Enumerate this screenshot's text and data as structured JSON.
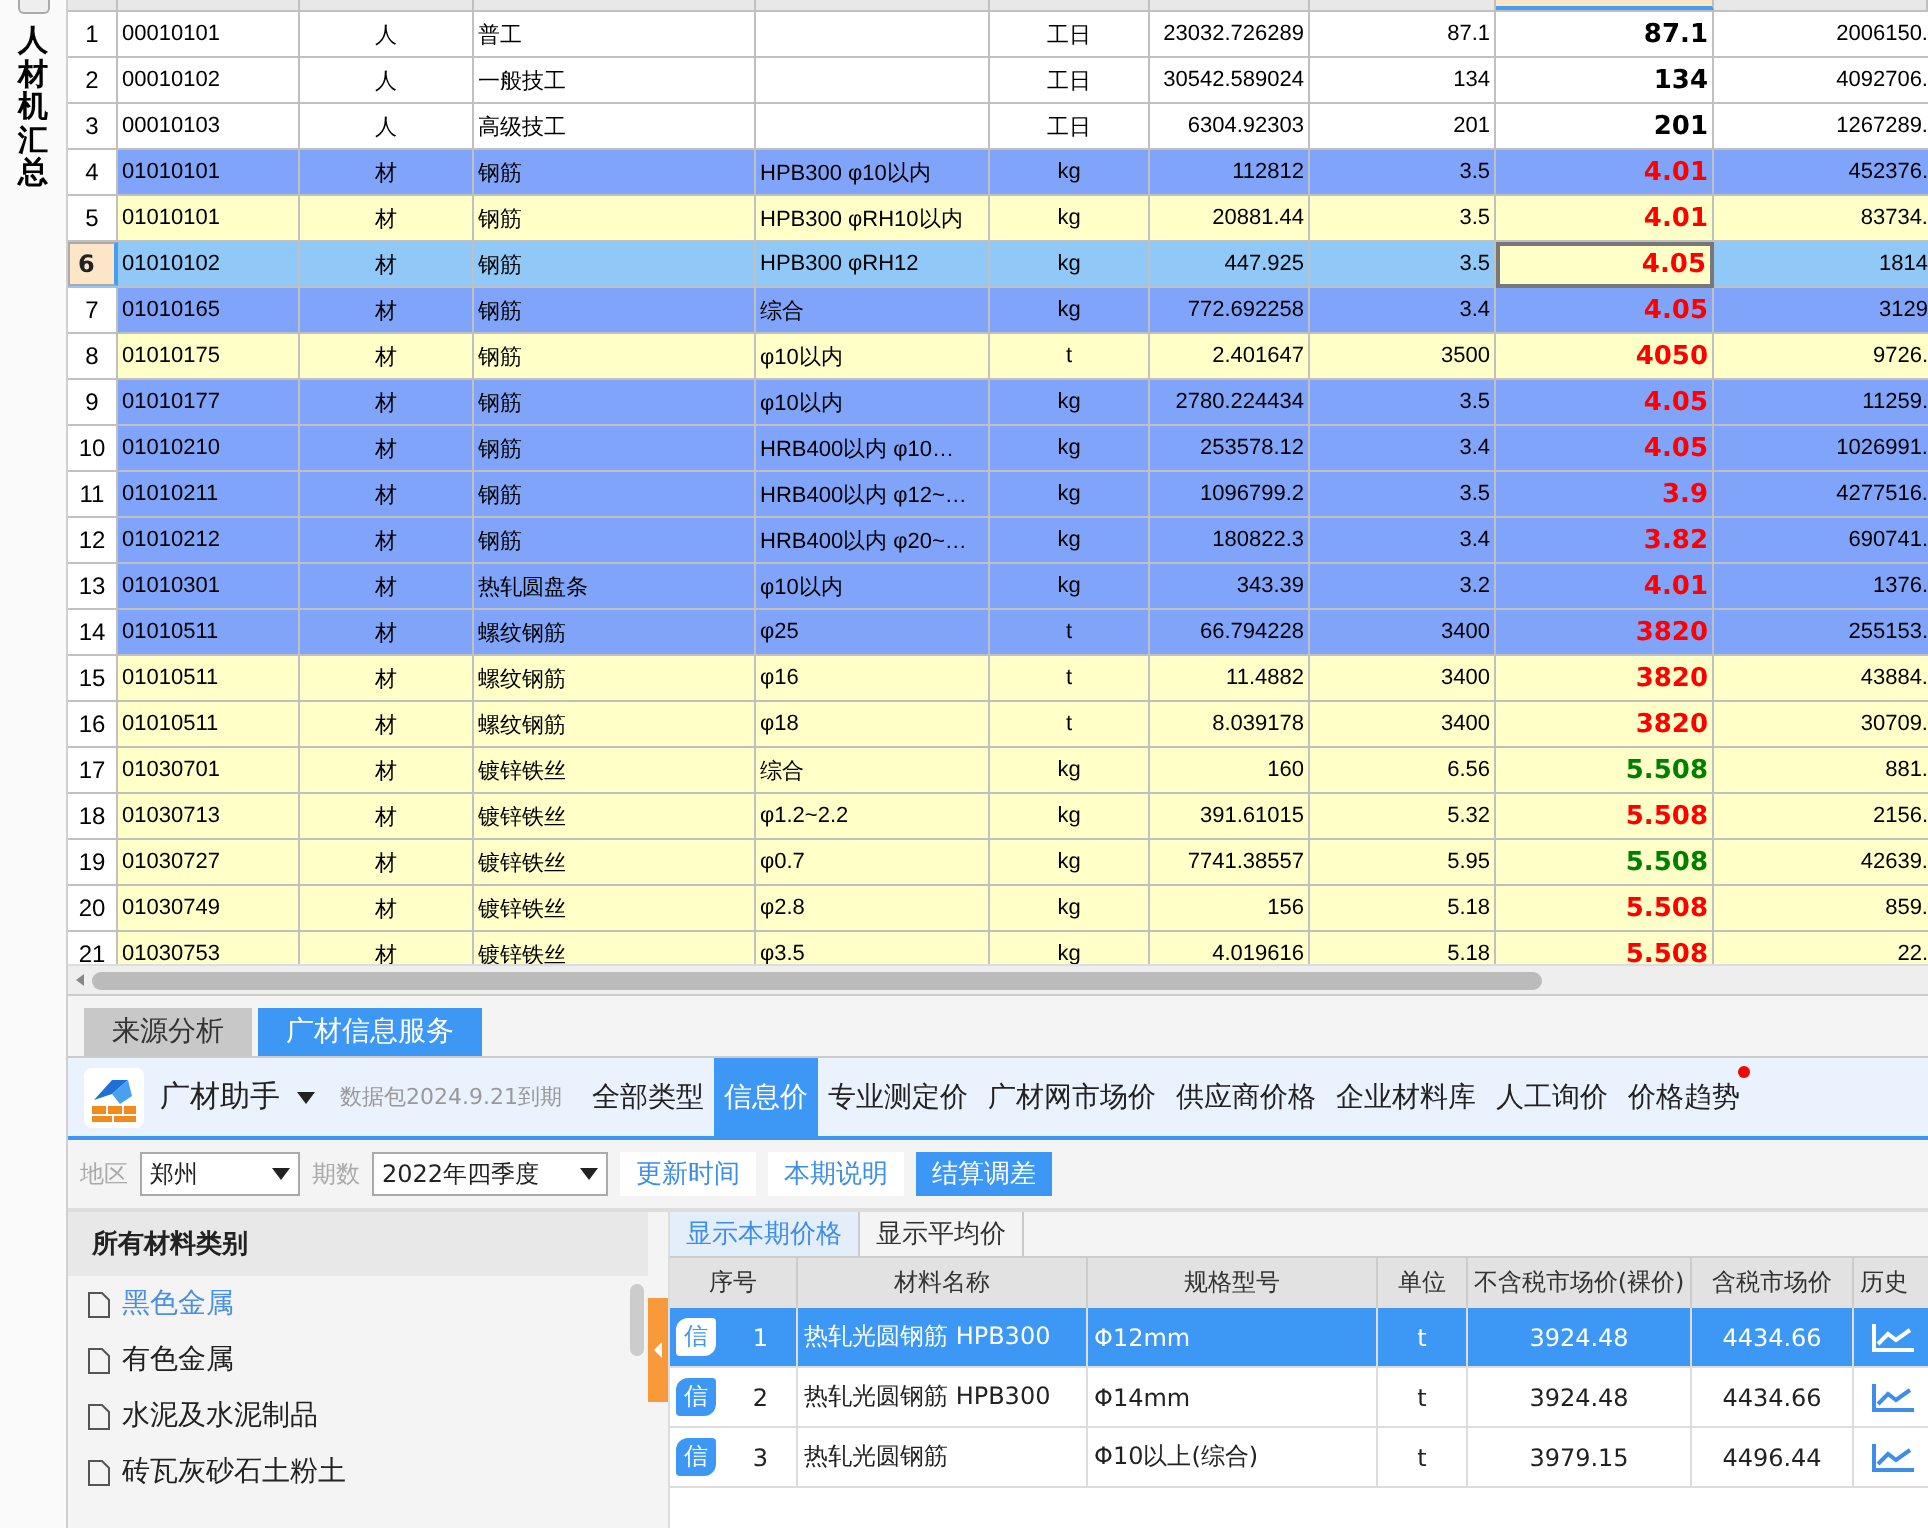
{
  "side_label": "人材机汇总",
  "grid": {
    "rows": [
      {
        "row_number": "1",
        "column_1": "00010101",
        "column_2": "人",
        "column_3": "普工",
        "column_5": "工日",
        "column_6": "23032.726289",
        "column_7": "87.1",
        "column_8": {
          "text": "87.1",
          "color": "#000000"
        },
        "column_9": "2006150.",
        "color": "#ffffff",
        "selected": false
      },
      {
        "row_number": "2",
        "column_1": "00010102",
        "column_2": "人",
        "column_3": "一般技工",
        "column_5": "工日",
        "column_6": "30542.589024",
        "column_7": "134",
        "column_8": {
          "text": "134",
          "color": "#000000"
        },
        "column_9": "4092706.",
        "color": "#ffffff",
        "selected": false
      },
      {
        "row_number": "3",
        "column_1": "00010103",
        "column_2": "人",
        "column_3": "高级技工",
        "column_5": "工日",
        "column_6": "6304.92303",
        "column_7": "201",
        "column_8": {
          "text": "201",
          "color": "#000000"
        },
        "column_9": "1267289.",
        "color": "#ffffff",
        "selected": false
      },
      {
        "row_number": "4",
        "column_1": "01010101",
        "column_2": "材",
        "column_3": "钢筋",
        "column_4": "HPB300 φ10以内",
        "column_5": "kg",
        "column_6": "112812",
        "column_7": "3.5",
        "column_8": {
          "text": "4.01",
          "color": "#ff0000"
        },
        "column_9": "452376.",
        "color": "#80a4fa",
        "selected": false
      },
      {
        "row_number": "5",
        "column_1": "01010101",
        "column_2": "材",
        "column_3": "钢筋",
        "column_4": "HPB300 φRH10以内",
        "column_5": "kg",
        "column_6": "20881.44",
        "column_7": "3.5",
        "column_8": {
          "text": "4.01",
          "color": "#ff0000"
        },
        "column_9": "83734.",
        "color": "#ffffc8",
        "selected": false
      },
      {
        "row_number": "6",
        "column_1": "01010102",
        "column_2": "材",
        "column_3": "钢筋",
        "column_4": "HPB300 φRH12",
        "column_5": "kg",
        "column_6": "447.925",
        "column_7": "3.5",
        "column_8": {
          "text": "4.05",
          "color": "#ff0000"
        },
        "column_9": "1814",
        "color": "#90c8f8",
        "selected": true
      },
      {
        "row_number": "7",
        "column_1": "01010165",
        "column_2": "材",
        "column_3": "钢筋",
        "column_4": "综合",
        "column_5": "kg",
        "column_6": "772.692258",
        "column_7": "3.4",
        "column_8": {
          "text": "4.05",
          "color": "#ff0000"
        },
        "column_9": "3129",
        "color": "#80a4fa",
        "selected": false
      },
      {
        "row_number": "8",
        "column_1": "01010175",
        "column_2": "材",
        "column_3": "钢筋",
        "column_4": "φ10以内",
        "column_5": "t",
        "column_6": "2.401647",
        "column_7": "3500",
        "column_8": {
          "text": "4050",
          "color": "#ff0000"
        },
        "column_9": "9726.",
        "color": "#ffffc8",
        "selected": false
      },
      {
        "row_number": "9",
        "column_1": "01010177",
        "column_2": "材",
        "column_3": "钢筋",
        "column_4": "φ10以内",
        "column_5": "kg",
        "column_6": "2780.224434",
        "column_7": "3.5",
        "column_8": {
          "text": "4.05",
          "color": "#ff0000"
        },
        "column_9": "11259.",
        "color": "#80a4fa",
        "selected": false
      },
      {
        "row_number": "10",
        "column_1": "01010210",
        "column_2": "材",
        "column_3": "钢筋",
        "column_4": "HRB400以内 φ10…",
        "column_5": "kg",
        "column_6": "253578.12",
        "column_7": "3.4",
        "column_8": {
          "text": "4.05",
          "color": "#ff0000"
        },
        "column_9": "1026991.",
        "color": "#80a4fa",
        "selected": false
      },
      {
        "row_number": "11",
        "column_1": "01010211",
        "column_2": "材",
        "column_3": "钢筋",
        "column_4": "HRB400以内 φ12~…",
        "column_5": "kg",
        "column_6": "1096799.2",
        "column_7": "3.5",
        "column_8": {
          "text": "3.9",
          "color": "#ff0000"
        },
        "column_9": "4277516.",
        "color": "#80a4fa",
        "selected": false
      },
      {
        "row_number": "12",
        "column_1": "01010212",
        "column_2": "材",
        "column_3": "钢筋",
        "column_4": "HRB400以内 φ20~…",
        "column_5": "kg",
        "column_6": "180822.3",
        "column_7": "3.4",
        "column_8": {
          "text": "3.82",
          "color": "#ff0000"
        },
        "column_9": "690741.",
        "color": "#80a4fa",
        "selected": false
      },
      {
        "row_number": "13",
        "column_1": "01010301",
        "column_2": "材",
        "column_3": "热轧圆盘条",
        "column_4": "φ10以内",
        "column_5": "kg",
        "column_6": "343.39",
        "column_7": "3.2",
        "column_8": {
          "text": "4.01",
          "color": "#ff0000"
        },
        "column_9": "1376.",
        "color": "#80a4fa",
        "selected": false
      },
      {
        "row_number": "14",
        "column_1": "01010511",
        "column_2": "材",
        "column_3": "螺纹钢筋",
        "column_4": "φ25",
        "column_5": "t",
        "column_6": "66.794228",
        "column_7": "3400",
        "column_8": {
          "text": "3820",
          "color": "#ff0000"
        },
        "column_9": "255153.",
        "color": "#80a4fa",
        "selected": false
      },
      {
        "row_number": "15",
        "column_1": "01010511",
        "column_2": "材",
        "column_3": "螺纹钢筋",
        "column_4": "φ16",
        "column_5": "t",
        "column_6": "11.4882",
        "column_7": "3400",
        "column_8": {
          "text": "3820",
          "color": "#ff0000"
        },
        "column_9": "43884.",
        "color": "#ffffc8",
        "selected": false
      },
      {
        "row_number": "16",
        "column_1": "01010511",
        "column_2": "材",
        "column_3": "螺纹钢筋",
        "column_4": "φ18",
        "column_5": "t",
        "column_6": "8.039178",
        "column_7": "3400",
        "column_8": {
          "text": "3820",
          "color": "#ff0000"
        },
        "column_9": "30709.",
        "color": "#ffffc8",
        "selected": false
      },
      {
        "row_number": "17",
        "column_1": "01030701",
        "column_2": "材",
        "column_3": "镀锌铁丝",
        "column_4": "综合",
        "column_5": "kg",
        "column_6": "160",
        "column_7": "6.56",
        "column_8": {
          "text": "5.508",
          "color": "#008000"
        },
        "column_9": "881.",
        "color": "#ffffc8",
        "selected": false
      },
      {
        "row_number": "18",
        "column_1": "01030713",
        "column_2": "材",
        "column_3": "镀锌铁丝",
        "column_4": "φ1.2~2.2",
        "column_5": "kg",
        "column_6": "391.61015",
        "column_7": "5.32",
        "column_8": {
          "text": "5.508",
          "color": "#ff0000"
        },
        "column_9": "2156.",
        "color": "#ffffc8",
        "selected": false
      },
      {
        "row_number": "19",
        "column_1": "01030727",
        "column_2": "材",
        "column_3": "镀锌铁丝",
        "column_4": "φ0.7",
        "column_5": "kg",
        "column_6": "7741.38557",
        "column_7": "5.95",
        "column_8": {
          "text": "5.508",
          "color": "#008000"
        },
        "column_9": "42639.",
        "color": "#ffffc8",
        "selected": false
      },
      {
        "row_number": "20",
        "column_1": "01030749",
        "column_2": "材",
        "column_3": "镀锌铁丝",
        "column_4": "φ2.8",
        "column_5": "kg",
        "column_6": "156",
        "column_7": "5.18",
        "column_8": {
          "text": "5.508",
          "color": "#ff0000"
        },
        "column_9": "859.",
        "color": "#ffffc8",
        "selected": false
      },
      {
        "row_number": "21",
        "column_1": "01030753",
        "column_2": "材",
        "column_3": "镀锌铁丝",
        "column_4": "φ3.5",
        "column_5": "kg",
        "column_6": "4.019616",
        "column_7": "5.18",
        "column_8": {
          "text": "5.508",
          "color": "#ff0000"
        },
        "column_9": "22.",
        "color": "#ffffc8",
        "selected": false
      }
    ]
  },
  "panel_tabs": [
    {
      "label": "来源分析",
      "selected": false
    },
    {
      "label": "广材信息服务",
      "selected": true
    }
  ],
  "assistant": {
    "title": "广材助手",
    "expiry": "数据包2024.9.21到期",
    "nav": [
      {
        "label": "全部类型",
        "selected": false,
        "badge": false
      },
      {
        "label": "信息价",
        "selected": true,
        "badge": false
      },
      {
        "label": "专业测定价",
        "selected": false,
        "badge": false
      },
      {
        "label": "广材网市场价",
        "selected": false,
        "badge": false
      },
      {
        "label": "供应商价格",
        "selected": false,
        "badge": false
      },
      {
        "label": "企业材料库",
        "selected": false,
        "badge": false
      },
      {
        "label": "人工询价",
        "selected": false,
        "badge": false
      },
      {
        "label": "价格趋势",
        "selected": false,
        "badge": true
      }
    ]
  },
  "filters": {
    "region_label": "地区",
    "region": "郑州",
    "period_label": "期数",
    "period": "2022年四季度",
    "buttons": [
      {
        "label": "更新时间",
        "kind": "plain"
      },
      {
        "label": "本期说明",
        "kind": "plain"
      },
      {
        "label": "结算调差",
        "kind": "primary"
      }
    ]
  },
  "categories": {
    "title": "所有材料类别",
    "items": [
      {
        "label": "黑色金属",
        "selected": true
      },
      {
        "label": "有色金属",
        "selected": false
      },
      {
        "label": "水泥及水泥制品",
        "selected": false
      },
      {
        "label": "砖瓦灰砂石土粉土",
        "selected": false
      }
    ]
  },
  "price_tabs": [
    {
      "label": "显示本期价格",
      "selected": true
    },
    {
      "label": "显示平均价",
      "selected": false
    }
  ],
  "prices": {
    "columns": [
      "序号",
      "材料名称",
      "规格型号",
      "单位",
      "不含税市场价(裸价)",
      "含税市场价",
      "历史"
    ],
    "rows": [
      {
        "badge": "信",
        "no": "1",
        "name": "热轧光圆钢筋 HPB300",
        "spec": "Φ12mm",
        "unit": "t",
        "price": "3924.48",
        "tax_price": "4434.66",
        "selected": true
      },
      {
        "badge": "信",
        "no": "2",
        "name": "热轧光圆钢筋 HPB300",
        "spec": "Φ14mm",
        "unit": "t",
        "price": "3924.48",
        "tax_price": "4434.66",
        "selected": false
      },
      {
        "badge": "信",
        "no": "3",
        "name": "热轧光圆钢筋",
        "spec": "Φ10以上(综合)",
        "unit": "t",
        "price": "3979.15",
        "tax_price": "4496.44",
        "selected": false
      }
    ]
  }
}
